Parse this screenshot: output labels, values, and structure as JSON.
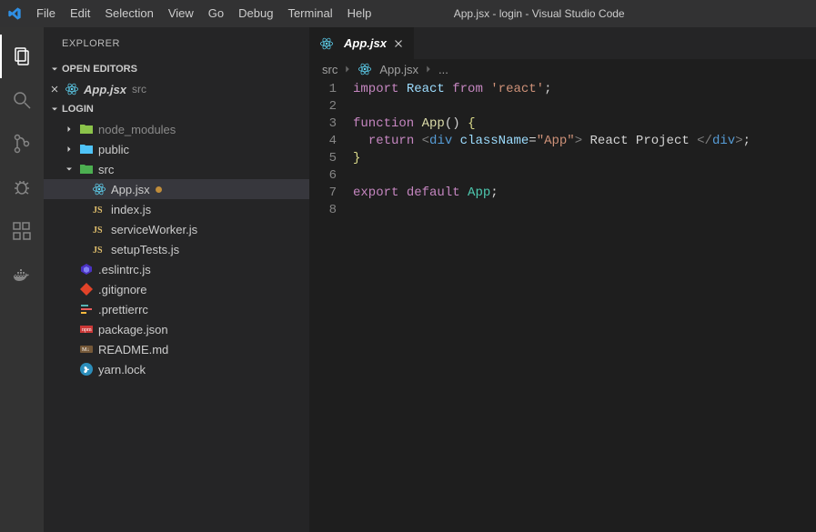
{
  "window": {
    "title": "App.jsx - login - Visual Studio Code"
  },
  "menu": [
    "File",
    "Edit",
    "Selection",
    "View",
    "Go",
    "Debug",
    "Terminal",
    "Help"
  ],
  "sidebar": {
    "title": "EXPLORER",
    "sections": {
      "openEditors": {
        "label": "OPEN EDITORS",
        "items": [
          {
            "name": "App.jsx",
            "path": "src"
          }
        ]
      },
      "folder": {
        "label": "LOGIN",
        "tree": [
          {
            "type": "folder",
            "name": "node_modules",
            "depth": 1,
            "expanded": false,
            "dim": true,
            "icon": "folder-node"
          },
          {
            "type": "folder",
            "name": "public",
            "depth": 1,
            "expanded": false,
            "icon": "folder-public"
          },
          {
            "type": "folder",
            "name": "src",
            "depth": 1,
            "expanded": true,
            "icon": "folder-src"
          },
          {
            "type": "file",
            "name": "App.jsx",
            "depth": 2,
            "icon": "react",
            "active": true,
            "modified": true
          },
          {
            "type": "file",
            "name": "index.js",
            "depth": 2,
            "icon": "js"
          },
          {
            "type": "file",
            "name": "serviceWorker.js",
            "depth": 2,
            "icon": "js"
          },
          {
            "type": "file",
            "name": "setupTests.js",
            "depth": 2,
            "icon": "js"
          },
          {
            "type": "file",
            "name": ".eslintrc.js",
            "depth": 1,
            "icon": "eslint"
          },
          {
            "type": "file",
            "name": ".gitignore",
            "depth": 1,
            "icon": "git"
          },
          {
            "type": "file",
            "name": ".prettierrc",
            "depth": 1,
            "icon": "prettier"
          },
          {
            "type": "file",
            "name": "package.json",
            "depth": 1,
            "icon": "npm"
          },
          {
            "type": "file",
            "name": "README.md",
            "depth": 1,
            "icon": "md"
          },
          {
            "type": "file",
            "name": "yarn.lock",
            "depth": 1,
            "icon": "yarn"
          }
        ]
      }
    }
  },
  "tab": {
    "label": "App.jsx"
  },
  "breadcrumbs": [
    {
      "label": "src",
      "icon": null
    },
    {
      "label": "App.jsx",
      "icon": "react"
    },
    {
      "label": "...",
      "icon": null
    }
  ],
  "code": {
    "lines": [
      [
        {
          "t": "kw",
          "s": "import"
        },
        {
          "t": "sp",
          "s": " "
        },
        {
          "t": "var",
          "s": "React"
        },
        {
          "t": "sp",
          "s": " "
        },
        {
          "t": "kw",
          "s": "from"
        },
        {
          "t": "sp",
          "s": " "
        },
        {
          "t": "str",
          "s": "'react'"
        },
        {
          "t": "punc",
          "s": ";"
        }
      ],
      [],
      [
        {
          "t": "kw",
          "s": "function"
        },
        {
          "t": "sp",
          "s": " "
        },
        {
          "t": "fn",
          "s": "App"
        },
        {
          "t": "punc",
          "s": "()"
        },
        {
          "t": "sp",
          "s": " "
        },
        {
          "t": "brace",
          "s": "{"
        }
      ],
      [
        {
          "t": "sp",
          "s": "  "
        },
        {
          "t": "kw",
          "s": "return"
        },
        {
          "t": "sp",
          "s": " "
        },
        {
          "t": "tag",
          "s": "<"
        },
        {
          "t": "tagname",
          "s": "div"
        },
        {
          "t": "sp",
          "s": " "
        },
        {
          "t": "attr",
          "s": "className"
        },
        {
          "t": "punc",
          "s": "="
        },
        {
          "t": "str",
          "s": "\"App\""
        },
        {
          "t": "tag",
          "s": ">"
        },
        {
          "t": "punc",
          "s": " React Project "
        },
        {
          "t": "tag",
          "s": "</"
        },
        {
          "t": "tagname",
          "s": "div"
        },
        {
          "t": "tag",
          "s": ">"
        },
        {
          "t": "punc",
          "s": ";"
        }
      ],
      [
        {
          "t": "brace",
          "s": "}"
        }
      ],
      [],
      [
        {
          "t": "kw",
          "s": "export"
        },
        {
          "t": "sp",
          "s": " "
        },
        {
          "t": "kw",
          "s": "default"
        },
        {
          "t": "sp",
          "s": " "
        },
        {
          "t": "type",
          "s": "App"
        },
        {
          "t": "punc",
          "s": ";"
        }
      ],
      []
    ]
  },
  "colors": {
    "modifiedDot": "#c08d3b"
  }
}
